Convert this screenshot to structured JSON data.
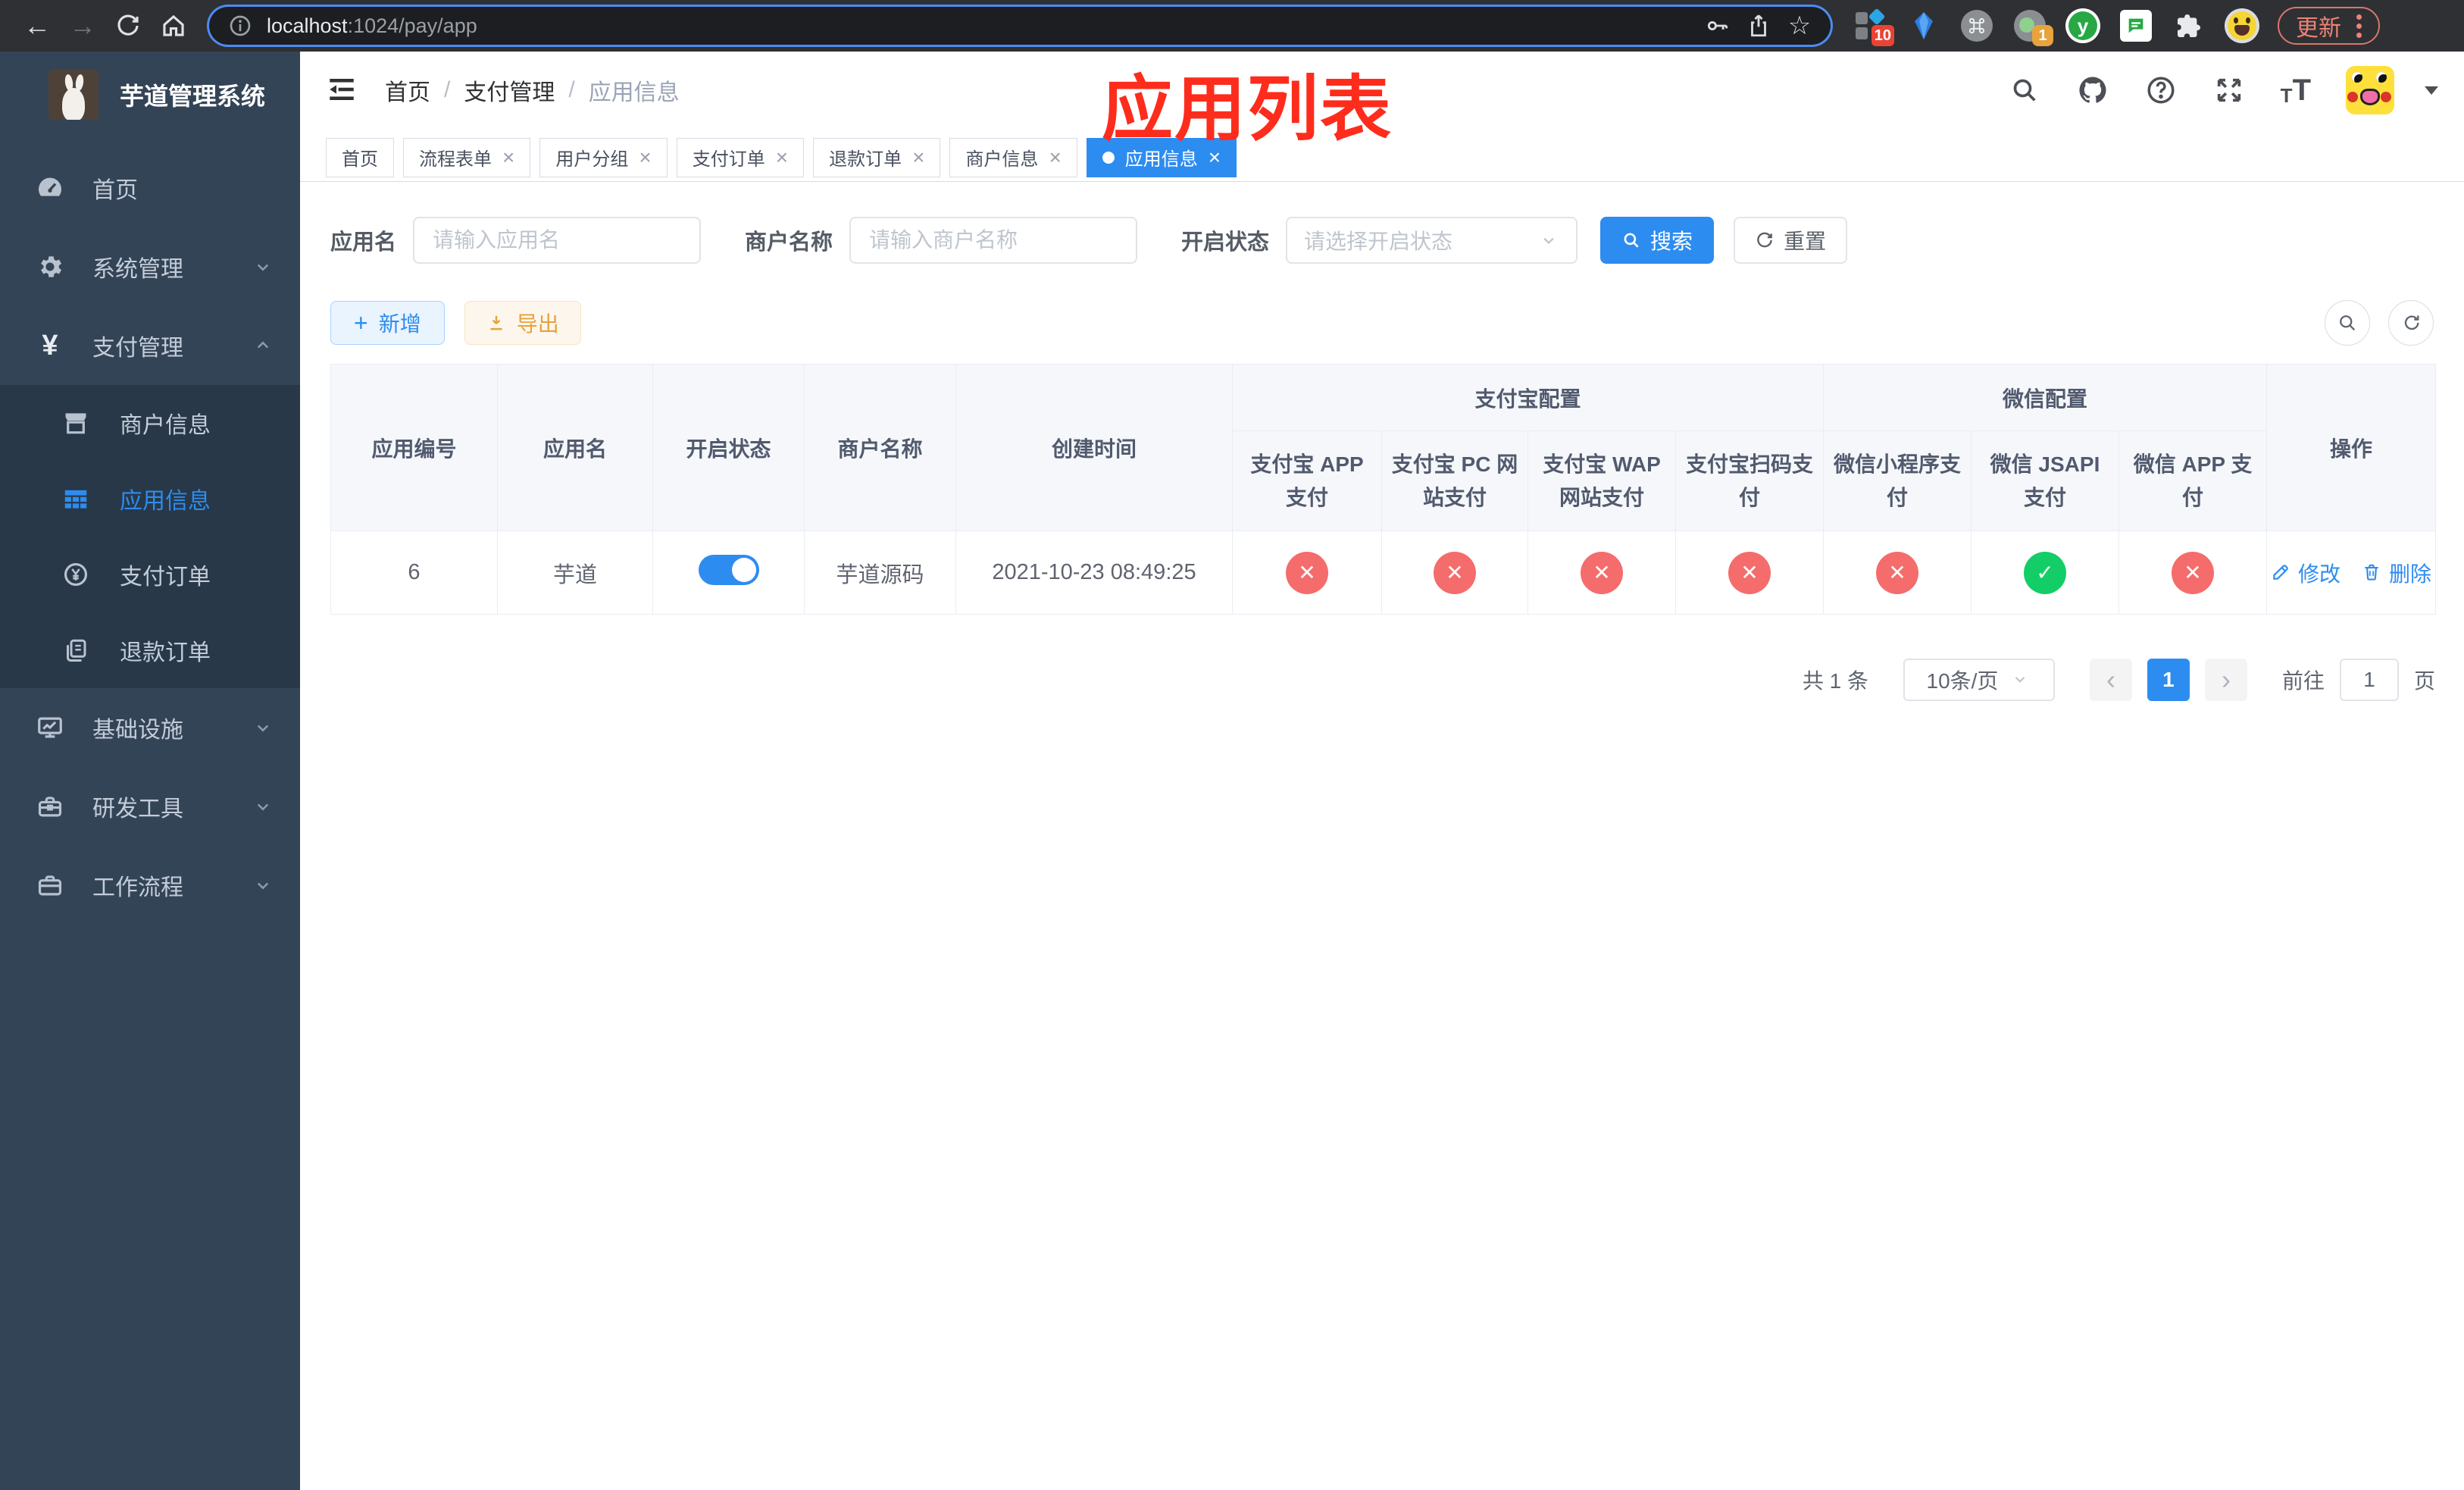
{
  "colors": {
    "primary": "#2d8cf0",
    "success": "#13ce66",
    "danger": "#f56c6c",
    "warning": "#e6a23c",
    "annotation": "#fe2c1c",
    "sidebar_bg": "#344457",
    "submenu_bg": "#283848"
  },
  "browser": {
    "url_host": "localhost",
    "url_rest": ":1024/pay/app",
    "update_label": "更新",
    "ext_badge_1": "10",
    "ext_badge_2": "1",
    "vue_ext_letter": "y"
  },
  "glyphs": {
    "back": "←",
    "forward": "→",
    "star": "☆",
    "close": "×",
    "plus": "+",
    "prev": "‹",
    "next": "›",
    "yen": "¥",
    "tt_small": "T",
    "tt_large": "T"
  },
  "sidebar": {
    "title": "芋道管理系统",
    "items": [
      {
        "label": "首页"
      },
      {
        "label": "系统管理"
      },
      {
        "label": "支付管理"
      },
      {
        "label": "基础设施"
      },
      {
        "label": "研发工具"
      },
      {
        "label": "工作流程"
      }
    ],
    "pay_children": [
      {
        "label": "商户信息"
      },
      {
        "label": "应用信息"
      },
      {
        "label": "支付订单"
      },
      {
        "label": "退款订单"
      }
    ]
  },
  "navbar": {
    "breadcrumb": [
      "首页",
      "支付管理",
      "应用信息"
    ],
    "separator": "/"
  },
  "annotation": {
    "text": "应用列表"
  },
  "tabs": [
    {
      "label": "首页"
    },
    {
      "label": "流程表单"
    },
    {
      "label": "用户分组"
    },
    {
      "label": "支付订单"
    },
    {
      "label": "退款订单"
    },
    {
      "label": "商户信息"
    },
    {
      "label": "应用信息"
    }
  ],
  "filters": {
    "app_name_label": "应用名",
    "app_name_placeholder": "请输入应用名",
    "merchant_label": "商户名称",
    "merchant_placeholder": "请输入商户名称",
    "status_label": "开启状态",
    "status_placeholder": "请选择开启状态",
    "search_label": "搜索",
    "reset_label": "重置"
  },
  "toolbar": {
    "add_label": "新增",
    "export_label": "导出"
  },
  "table": {
    "columns": [
      "应用编号",
      "应用名",
      "开启状态",
      "商户名称",
      "创建时间"
    ],
    "groups": [
      {
        "label": "支付宝配置",
        "children": [
          "支付宝 APP 支付",
          "支付宝 PC 网站支付",
          "支付宝 WAP 网站支付",
          "支付宝扫码支付"
        ]
      },
      {
        "label": "微信配置",
        "children": [
          "微信小程序支付",
          "微信 JSAPI 支付",
          "微信 APP 支付"
        ]
      }
    ],
    "op_column": "操作",
    "rows": [
      {
        "id": "6",
        "name": "芋道",
        "enabled": true,
        "merchant": "芋道源码",
        "created": "2021-10-23 08:49:25",
        "channels": [
          {
            "status": "off",
            "glyph": "✕"
          },
          {
            "status": "off",
            "glyph": "✕"
          },
          {
            "status": "off",
            "glyph": "✕"
          },
          {
            "status": "off",
            "glyph": "✕"
          },
          {
            "status": "off",
            "glyph": "✕"
          },
          {
            "status": "on",
            "glyph": "✓"
          },
          {
            "status": "off",
            "glyph": "✕"
          }
        ],
        "edit_label": "修改",
        "delete_label": "删除"
      }
    ]
  },
  "pagination": {
    "total": "共 1 条",
    "page_size": "10条/页",
    "current_page": "1",
    "goto_label": "前往",
    "goto_value": "1",
    "page_suffix": "页"
  }
}
